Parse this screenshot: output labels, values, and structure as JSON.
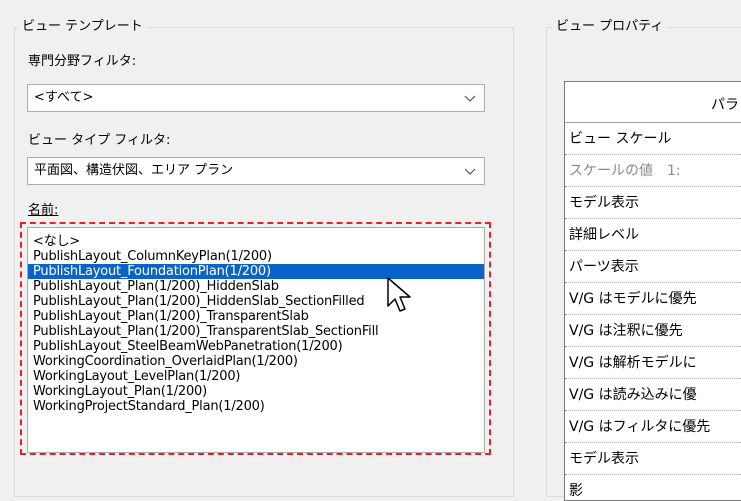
{
  "view_template_group": {
    "title": "ビュー テンプレート",
    "discipline_filter_label": "専門分野フィルタ:",
    "discipline_filter_value": "<すべて>",
    "view_type_filter_label": "ビュー タイプ フィルタ:",
    "view_type_filter_value": "平面図、構造伏図、エリア プラン",
    "names_label": "名前:",
    "names": [
      "<なし>",
      "PublishLayout_ColumnKeyPlan(1/200)",
      "PublishLayout_FoundationPlan(1/200)",
      "PublishLayout_Plan(1/200)_HiddenSlab",
      "PublishLayout_Plan(1/200)_HiddenSlab_SectionFilled",
      "PublishLayout_Plan(1/200)_TransparentSlab",
      "PublishLayout_Plan(1/200)_TransparentSlab_SectionFill",
      "PublishLayout_SteelBeamWebPanetration(1/200)",
      "WorkingCoordination_OverlaidPlan(1/200)",
      "WorkingLayout_LevelPlan(1/200)",
      "WorkingLayout_Plan(1/200)",
      "WorkingProjectStandard_Plan(1/200)"
    ],
    "selected_name": "PublishLayout_FoundationPlan(1/200)"
  },
  "view_properties_group": {
    "title": "ビュー プロパティ",
    "header": "パラ",
    "rows": [
      "ビュー スケール",
      "スケールの値　1:",
      "モデル表示",
      "詳細レベル",
      "パーツ表示",
      "V/G はモデルに優先",
      "V/G は注釈に優先",
      "V/G は解析モデルに",
      "V/G は読み込みに優",
      "V/G はフィルタに優先",
      "モデル表示",
      "影"
    ]
  },
  "icons": {
    "dropdown": "chevron-down-icon",
    "cursor": "mouse-pointer-icon"
  },
  "colors": {
    "selection": "#0a64c8",
    "highlight_box": "#e8202a"
  }
}
